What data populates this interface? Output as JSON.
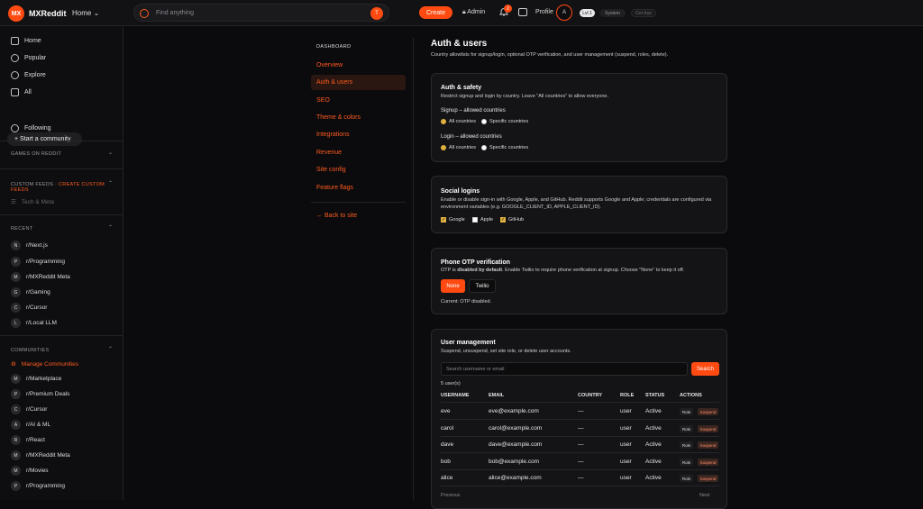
{
  "topbar": {
    "logo_text": "MX",
    "brand": "MXReddit",
    "home_select": "Home",
    "search_placeholder": "Find anything",
    "search_orb": "T",
    "create_label": "Create",
    "admin_label": "Admin",
    "notif_count": "2",
    "profile_label": "Profile",
    "avatar_letter": "A",
    "pills": [
      "Lvl 1",
      "System",
      "Get App"
    ]
  },
  "sidebar": {
    "nav": [
      "Home",
      "Popular",
      "Explore",
      "All"
    ],
    "start_community": "Start a community",
    "following": "Following",
    "games_header": "GAMES ON REDDIT",
    "custom_feeds_header": "CUSTOM FEEDS",
    "create_custom_feeds": "CREATE CUSTOM FEEDS",
    "custom_feed_item": "Tech & Meta",
    "recent_header": "RECENT",
    "recent": [
      {
        "letter": "N",
        "name": "r/Next.js"
      },
      {
        "letter": "P",
        "name": "r/Programming"
      },
      {
        "letter": "M",
        "name": "r/MXReddit Meta"
      },
      {
        "letter": "G",
        "name": "r/Gaming"
      },
      {
        "letter": "C",
        "name": "r/Cursor"
      },
      {
        "letter": "L",
        "name": "r/Local LLM"
      }
    ],
    "communities_header": "COMMUNITIES",
    "manage_communities": "Manage Communities",
    "communities": [
      {
        "letter": "M",
        "name": "r/Marketplace"
      },
      {
        "letter": "P",
        "name": "r/Premium Deals"
      },
      {
        "letter": "C",
        "name": "r/Cursor"
      },
      {
        "letter": "A",
        "name": "r/AI & ML"
      },
      {
        "letter": "R",
        "name": "r/React"
      },
      {
        "letter": "M",
        "name": "r/MXReddit Meta"
      },
      {
        "letter": "M",
        "name": "r/Movies"
      },
      {
        "letter": "P",
        "name": "r/Programming"
      }
    ]
  },
  "settings_nav": {
    "heading": "DASHBOARD",
    "items": [
      "Overview",
      "Auth & users",
      "SEO",
      "Theme & colors",
      "Integrations",
      "Revenue",
      "Site config",
      "Feature flags"
    ],
    "active_index": 1,
    "back": "← Back to site"
  },
  "page": {
    "title": "Auth & users",
    "lead": "Country allowlists for signup/login, optional OTP verification, and user management (suspend, roles, delete)."
  },
  "auth_safety": {
    "title": "Auth & safety",
    "desc": "Restrict signup and login by country. Leave \"All countries\" to allow everyone.",
    "signup_label": "Signup – allowed countries",
    "login_label": "Login – allowed countries",
    "opt_all": "All countries",
    "opt_specific": "Specific countries"
  },
  "social": {
    "title": "Social logins",
    "desc": "Enable or disable sign-in with Google, Apple, and GitHub. Reddit supports Google and Apple; credentials are configured via environment variables (e.g. GOOGLE_CLIENT_ID, APPLE_CLIENT_ID).",
    "google": "Google",
    "apple": "Apple",
    "github": "GitHub"
  },
  "otp": {
    "title": "Phone OTP verification",
    "desc_pre": "OTP is ",
    "desc_bold": "disabled by default",
    "desc_post": ". Enable Twilio to require phone verification at signup. Choose \"None\" to keep it off.",
    "none_label": "None",
    "twilio_label": "Twilio",
    "current": "Current: OTP disabled."
  },
  "users": {
    "title": "User management",
    "desc": "Suspend, unsuspend, set site role, or delete user accounts.",
    "search_placeholder": "Search username or email",
    "search_button": "Search",
    "count": "5 user(s)",
    "columns": [
      "USERNAME",
      "EMAIL",
      "COUNTRY",
      "ROLE",
      "STATUS",
      "ACTIONS"
    ],
    "rows": [
      {
        "username": "eve",
        "email": "eve@example.com",
        "country": "—",
        "role": "user",
        "status": "Active"
      },
      {
        "username": "carol",
        "email": "carol@example.com",
        "country": "—",
        "role": "user",
        "status": "Active"
      },
      {
        "username": "dave",
        "email": "dave@example.com",
        "country": "—",
        "role": "user",
        "status": "Active"
      },
      {
        "username": "bob",
        "email": "bob@example.com",
        "country": "—",
        "role": "user",
        "status": "Active"
      },
      {
        "username": "alice",
        "email": "alice@example.com",
        "country": "—",
        "role": "user",
        "status": "Active"
      }
    ],
    "role_btn": "Role",
    "suspend_btn": "Suspend",
    "previous": "Previous",
    "next": "Next"
  }
}
